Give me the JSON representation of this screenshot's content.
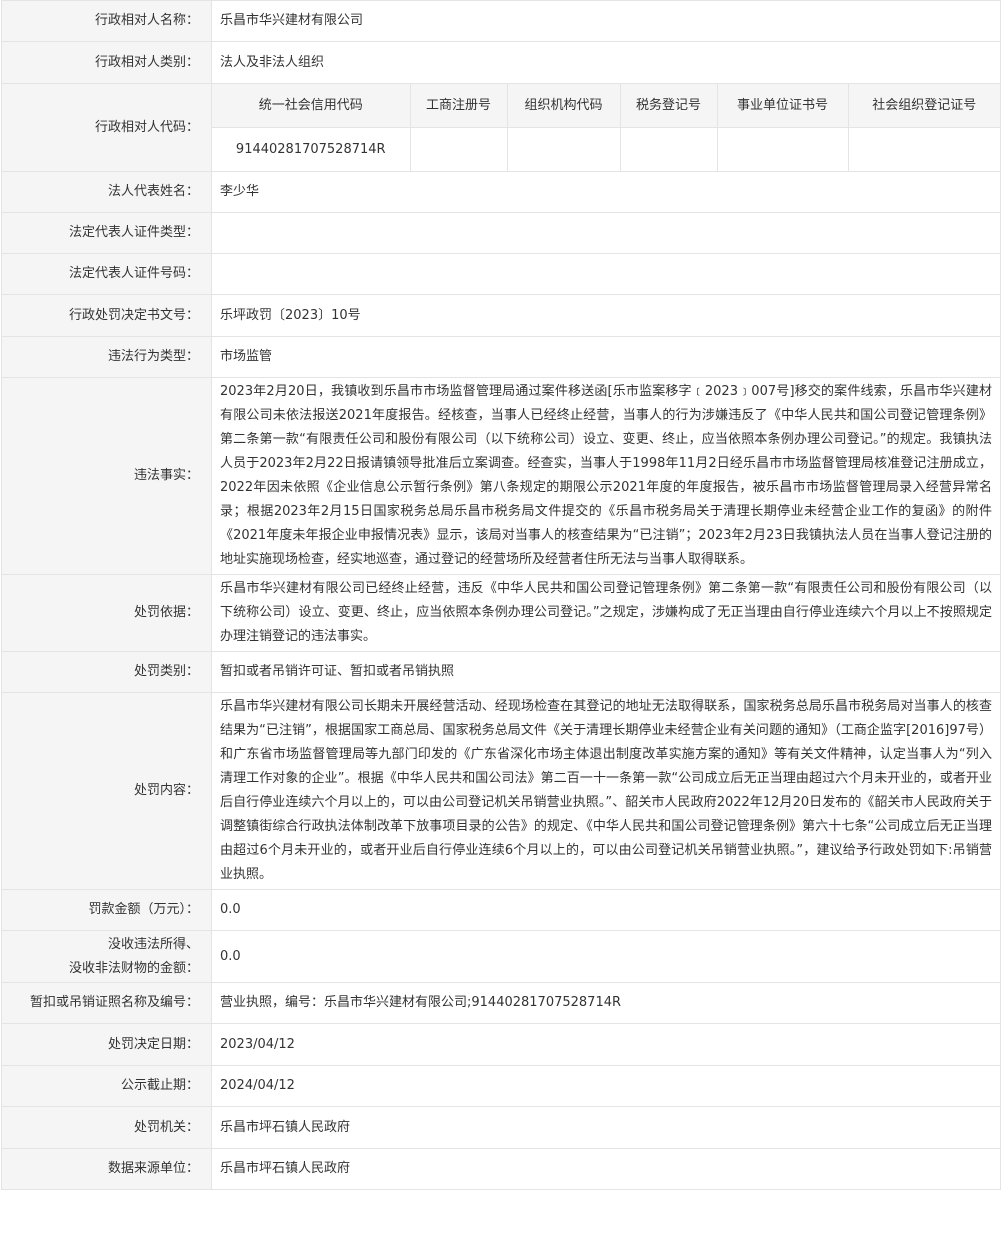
{
  "rows": {
    "party_name": {
      "label": "行政相对人名称：",
      "value": "乐昌市华兴建材有限公司"
    },
    "party_type": {
      "label": "行政相对人类别：",
      "value": "法人及非法人组织"
    },
    "party_code": {
      "label": "行政相对人代码："
    },
    "legal_rep": {
      "label": "法人代表姓名：",
      "value": "李少华"
    },
    "id_type": {
      "label": "法定代表人证件类型：",
      "value": ""
    },
    "id_number": {
      "label": "法定代表人证件号码：",
      "value": ""
    },
    "decision_no": {
      "label": "行政处罚决定书文号：",
      "value": "乐坪政罚〔2023〕10号"
    },
    "violation_type": {
      "label": "违法行为类型：",
      "value": "市场监管"
    },
    "facts": {
      "label": "违法事实：",
      "value": "2023年2月20日，我镇收到乐昌市市场监督管理局通过案件移送函[乐市监案移字﹝2023﹞007号]移交的案件线索，乐昌市华兴建材有限公司未依法报送2021年度报告。经核查，当事人已经终止经营，当事人的行为涉嫌违反了《中华人民共和国公司登记管理条例》第二条第一款“有限责任公司和股份有限公司（以下统称公司）设立、变更、终止，应当依照本条例办理公司登记。”的规定。我镇执法人员于2023年2月22日报请镇领导批准后立案调查。经查实，当事人于1998年11月2日经乐昌市市场监督管理局核准登记注册成立，2022年因未依照《企业信息公示暂行条例》第八条规定的期限公示2021年度的年度报告，被乐昌市市场监督管理局录入经营异常名录；根据2023年2月15日国家税务总局乐昌市税务局文件提交的《乐昌市税务局关于清理长期停业未经营企业工作的复函》的附件《2021年度未年报企业申报情况表》显示，该局对当事人的核查结果为“已注销”；2023年2月23日我镇执法人员在当事人登记注册的地址实施现场检查，经实地巡查，通过登记的经营场所及经营者住所无法与当事人取得联系。"
    },
    "basis": {
      "label": "处罚依据：",
      "value": "乐昌市华兴建材有限公司已经终止经营，违反《中华人民共和国公司登记管理条例》第二条第一款“有限责任公司和股份有限公司（以下统称公司）设立、变更、终止，应当依照本条例办理公司登记。”之规定，涉嫌构成了无正当理由自行停业连续六个月以上不按照规定办理注销登记的违法事实。"
    },
    "category": {
      "label": "处罚类别：",
      "value": "暂扣或者吊销许可证、暂扣或者吊销执照"
    },
    "content": {
      "label": "处罚内容：",
      "value": "乐昌市华兴建材有限公司长期未开展经营活动、经现场检查在其登记的地址无法取得联系，国家税务总局乐昌市税务局对当事人的核查结果为“已注销”，根据国家工商总局、国家税务总局文件《关于清理长期停业未经营企业有关问题的通知》（工商企监字[2016]97号）和广东省市场监督管理局等九部门印发的《广东省深化市场主体退出制度改革实施方案的通知》等有关文件精神，认定当事人为“列入清理工作对象的企业”。根据《中华人民共和国公司法》第二百一十一条第一款“公司成立后无正当理由超过六个月未开业的，或者开业后自行停业连续六个月以上的，可以由公司登记机关吊销营业执照。”、韶关市人民政府2022年12月20日发布的《韶关市人民政府关于调整镇街综合行政执法体制改革下放事项目录的公告》的规定、《中华人民共和国公司登记管理条例》第六十七条“公司成立后无正当理由超过6个月未开业的，或者开业后自行停业连续6个月以上的，可以由公司登记机关吊销营业执照。”，建议给予行政处罚如下:吊销营业执照。"
    },
    "fine": {
      "label": "罚款金额（万元）：",
      "value": "0.0"
    },
    "confiscation": {
      "label_line1": "没收违法所得、",
      "label_line2": "没收非法财物的金额：",
      "value": "0.0"
    },
    "license": {
      "label": "暂扣或吊销证照名称及编号：",
      "value": "营业执照，编号：乐昌市华兴建材有限公司;91440281707528714R"
    },
    "decision_date": {
      "label": "处罚决定日期：",
      "value": "2023/04/12"
    },
    "publish_deadline": {
      "label": "公示截止期：",
      "value": "2024/04/12"
    },
    "authority": {
      "label": "处罚机关：",
      "value": "乐昌市坪石镇人民政府"
    },
    "source_unit": {
      "label": "数据来源单位：",
      "value": "乐昌市坪石镇人民政府"
    }
  },
  "codes": {
    "headers": [
      "统一社会信用代码",
      "工商注册号",
      "组织机构代码",
      "税务登记号",
      "事业单位证书号",
      "社会组织登记证号"
    ],
    "values": [
      "91440281707528714R",
      "",
      "",
      "",
      "",
      ""
    ]
  }
}
